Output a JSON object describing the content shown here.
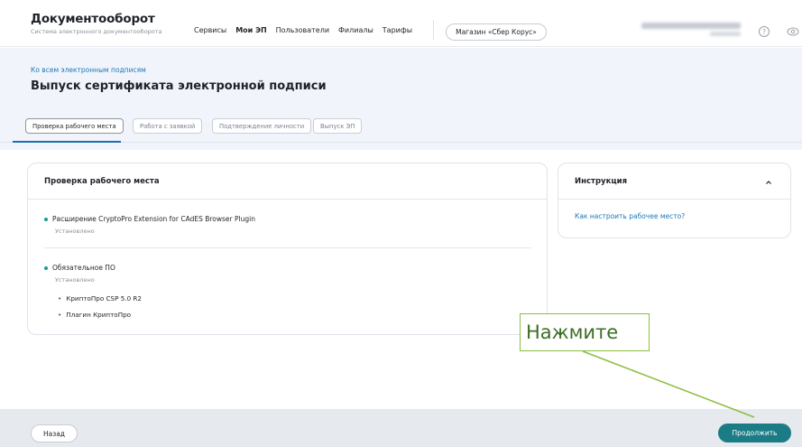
{
  "header": {
    "logo_title": "Документооборот",
    "logo_subtitle": "Система электронного документооборота",
    "nav": [
      "Сервисы",
      "Мои ЭП",
      "Пользователи",
      "Филиалы",
      "Тарифы"
    ],
    "store_button": "Магазин «Сбер Корус»",
    "help_icon": "?"
  },
  "page": {
    "back_link": "Ко всем электронным подписям",
    "title": "Выпуск сертификата электронной подписи",
    "steps": [
      "Проверка рабочего места",
      "Работа с заявкой",
      "Подтверждение личности",
      "Выпуск ЭП"
    ]
  },
  "workplace_card": {
    "title": "Проверка рабочего места",
    "items": [
      {
        "label": "Расширение CryptoPro Extension for CAdES Browser Plugin",
        "status": "Установлено"
      },
      {
        "label": "Обязательное ПО",
        "status": "Установлено",
        "subitems": [
          "КриптоПро CSP 5.0 R2",
          "Плагин КриптоПро"
        ]
      }
    ]
  },
  "instruction_card": {
    "title": "Инструкция",
    "link": "Как настроить рабочее место?"
  },
  "footer": {
    "back_button": "Назад",
    "next_button": "Продолжить"
  },
  "annotation": {
    "text": "Нажмите"
  },
  "colors": {
    "accent": "#1b7c86",
    "link": "#1b79b8",
    "callout_border": "#8cbf3f",
    "status_dot": "#1b9a8f"
  }
}
